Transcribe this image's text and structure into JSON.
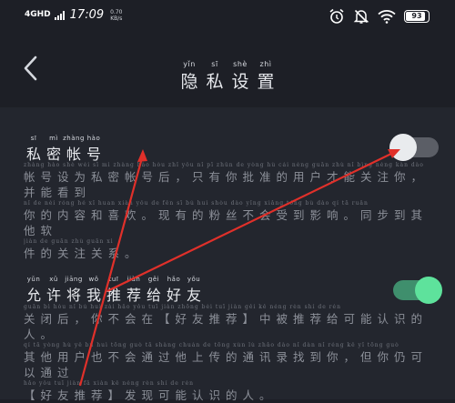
{
  "status_bar": {
    "network": "4GHD",
    "time": "17:09",
    "speed_value": "0.70",
    "speed_unit": "KB/s",
    "battery": "93",
    "battery_level": 0.93,
    "icons": [
      "alarm-icon",
      "mute-bell-icon",
      "wifi-icon",
      "battery-icon"
    ]
  },
  "header": {
    "title_pinyin": [
      "yǐn",
      "sī",
      "shè",
      "zhì"
    ],
    "title_chars": [
      "隐",
      "私",
      "设",
      "置"
    ]
  },
  "settings": [
    {
      "title_pinyin": [
        "sī",
        "mì",
        "zhàng",
        "hào"
      ],
      "title_chars": [
        "私",
        "密",
        "帐",
        "号"
      ],
      "desc_pinyin_1": "zhàng hào shè wéi sī mì zhàng hào hòu zhǐ yǒu nǐ pī zhǔn de yòng hù cái néng guān zhù nǐ bìng néng kàn dào",
      "desc_1": "帐号设为私密帐号后，只有你批准的用户才能关注你，并能看到",
      "desc_pinyin_2": "nǐ de nèi róng hé xǐ huan xiàn yǒu de fěn sī bú huì shòu dào yǐng xiǎng tóng bù dào qí tā ruǎn",
      "desc_2": "你的内容和喜欢。现有的粉丝不会受到影响。同步到其他软",
      "desc_pinyin_3": "jiàn de guān zhù guān xì",
      "desc_3": "件的关注关系。",
      "enabled": false
    },
    {
      "title_pinyin": [
        "yǔn",
        "xǔ",
        "jiāng",
        "wǒ",
        "tuī",
        "jiàn",
        "gěi",
        "hǎo",
        "yǒu"
      ],
      "title_chars": [
        "允",
        "许",
        "将",
        "我",
        "推",
        "荐",
        "给",
        "好",
        "友"
      ],
      "desc_pinyin_1": "guān bì hòu nǐ bú huì zài hǎo yǒu tuī jiàn zhōng bèi tuī jiàn gěi kě néng rèn shí de rén",
      "desc_1": "关闭后，你不会在【好友推荐】中被推荐给可能认识的人。",
      "desc_pinyin_2": "qí tā yòng hù yě bú huì tōng guò tā shàng chuán de tōng xùn lù zhǎo dào nǐ dàn nǐ réng kě yǐ tōng guò",
      "desc_2": "其他用户也不会通过他上传的通讯录找到你，但你仍可以通过",
      "desc_pinyin_3": "hǎo yǒu tuī jiàn fā xiàn kě néng rèn shí de rén",
      "desc_3": "【好友推荐】发现可能认识的人。",
      "enabled": true
    }
  ],
  "colors": {
    "background": "#1d1f26",
    "card": "#23262e",
    "toggle_on": "#5ee29c",
    "annotation_arrow": "#e0302a"
  }
}
